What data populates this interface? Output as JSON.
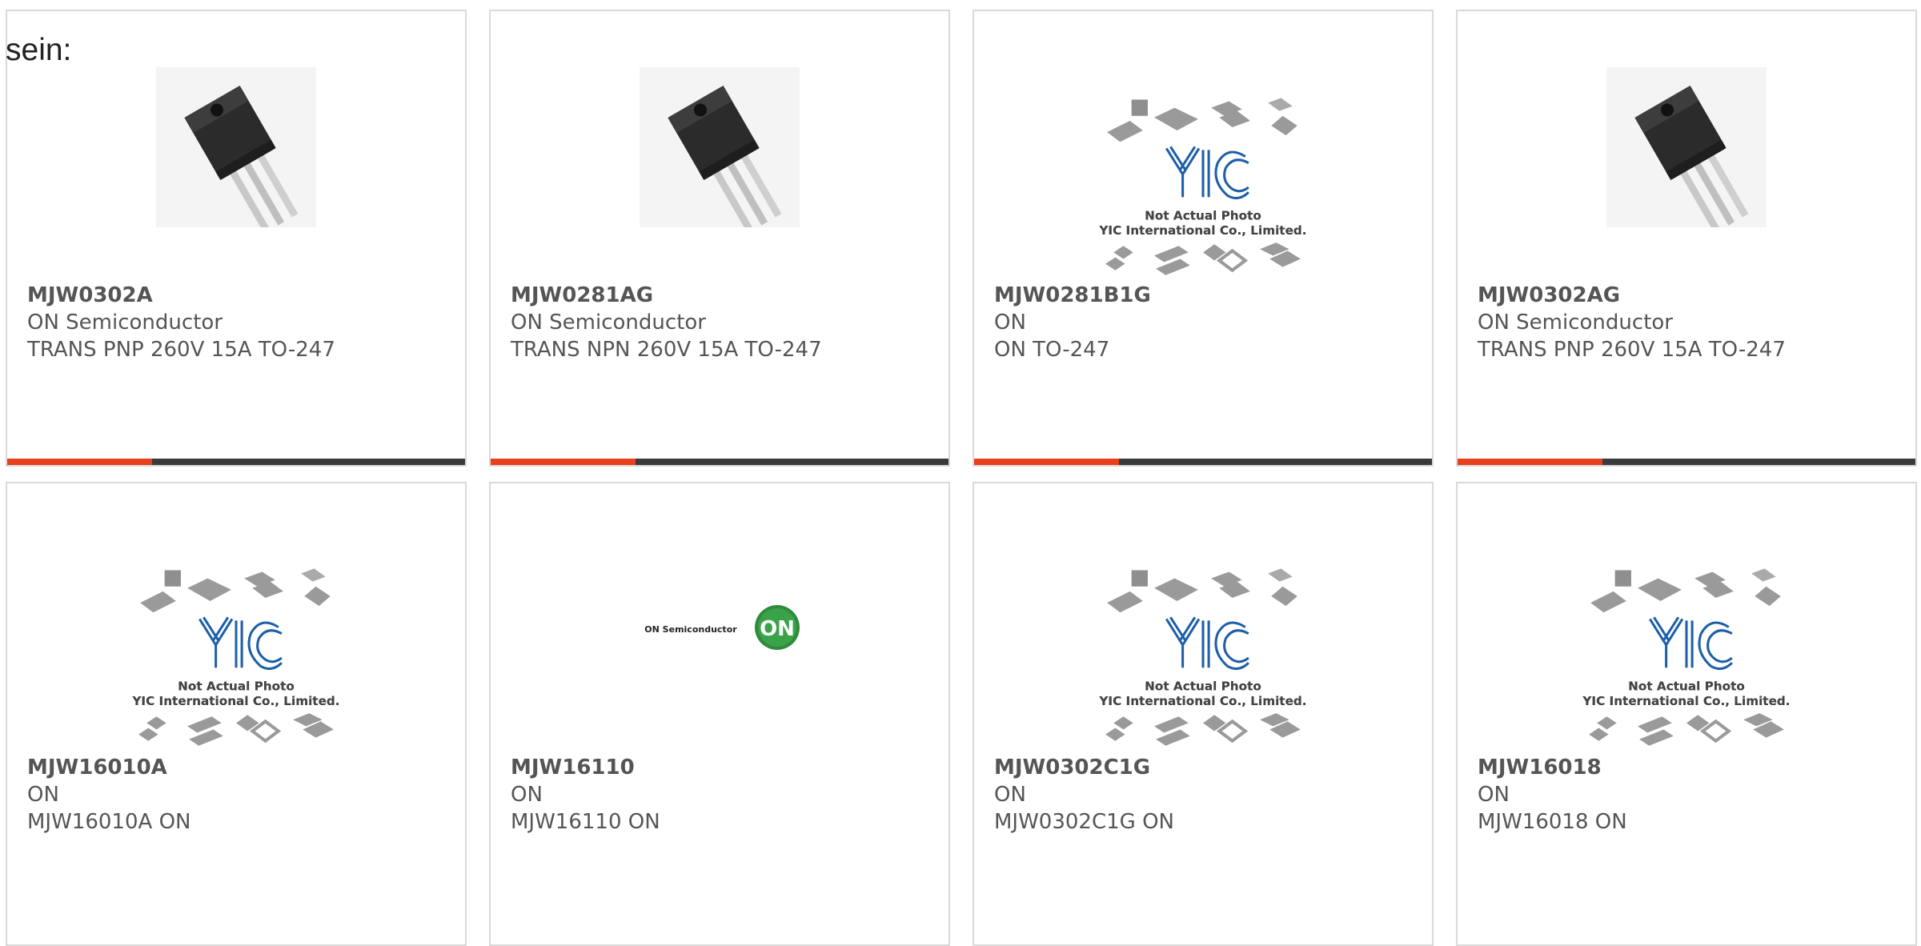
{
  "intro_text": "sein:",
  "colors": {
    "accent_bar": "#e8401c",
    "dark_bar": "#3a3a3a",
    "card_border": "#d9d9d9",
    "text": "#555555"
  },
  "cards": [
    {
      "part": "MJW0302A",
      "maker": "ON Semiconductor",
      "desc": "TRANS PNP 260V 15A TO-247",
      "image": "to247-transistor-photo"
    },
    {
      "part": "MJW0281AG",
      "maker": "ON Semiconductor",
      "desc": "TRANS NPN 260V 15A TO-247",
      "image": "to247-transistor-photo"
    },
    {
      "part": "MJW0281B1G",
      "maker": "ON",
      "desc": "ON TO-247",
      "image": "yic-placeholder"
    },
    {
      "part": "MJW0302AG",
      "maker": "ON Semiconductor",
      "desc": "TRANS PNP 260V 15A TO-247",
      "image": "to247-transistor-photo"
    },
    {
      "part": "MJW16010A",
      "maker": "ON",
      "desc": "MJW16010A ON",
      "image": "yic-placeholder"
    },
    {
      "part": "MJW16110",
      "maker": "ON",
      "desc": "MJW16110 ON",
      "image": "on-semiconductor-logo"
    },
    {
      "part": "MJW0302C1G",
      "maker": "ON",
      "desc": "MJW0302C1G ON",
      "image": "yic-placeholder"
    },
    {
      "part": "MJW16018",
      "maker": "ON",
      "desc": "MJW16018 ON",
      "image": "yic-placeholder"
    }
  ],
  "placeholder_text": {
    "line1": "Not Actual Photo",
    "line2": "YIC International Co., Limited."
  },
  "on_logo": {
    "wordmark": "ON Semiconductor",
    "mark": "ON"
  }
}
